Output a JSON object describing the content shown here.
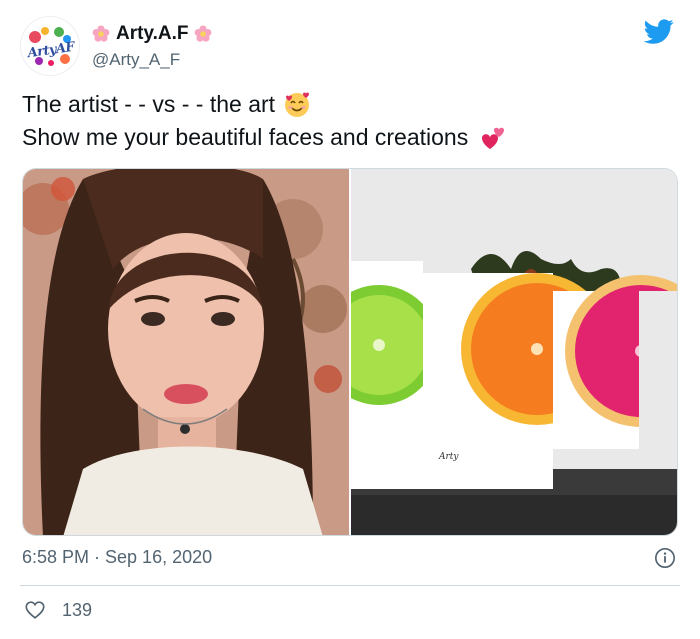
{
  "tweet": {
    "author": {
      "display_name": "Arty.A.F",
      "handle": "@Arty_A_F",
      "avatar_text": "ArtyAF",
      "name_decoration_icon": "flower-emoji"
    },
    "text_lines": [
      {
        "text": "The artist - - vs - - the art",
        "emoji": "smiling-face-with-hearts-emoji"
      },
      {
        "text": "Show me your beautiful faces and creations",
        "emoji": "two-hearts-emoji"
      }
    ],
    "media": [
      {
        "name": "selfie-photo",
        "description_icon": "photo"
      },
      {
        "name": "citrus-art-photo",
        "description_icon": "photo",
        "signature": "Arty"
      }
    ],
    "timestamp": "6:58 PM · Sep 16, 2020",
    "likes": "139",
    "colors": {
      "twitter_blue": "#1d9bf0",
      "text_primary": "#0f1419",
      "text_secondary": "#536471",
      "border": "#cfd9de"
    },
    "icons": [
      "twitter-bird-icon",
      "info-icon",
      "heart-icon"
    ]
  }
}
